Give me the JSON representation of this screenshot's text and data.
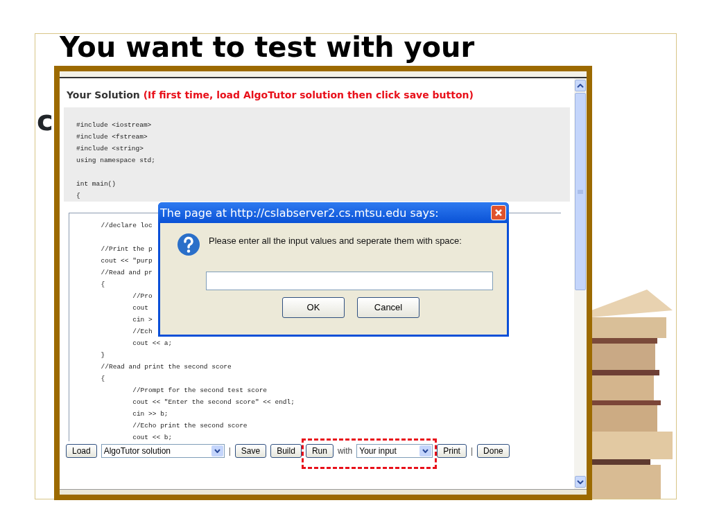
{
  "slide": {
    "title_line_1": "You want to test with your",
    "title_line_2_fragment": "c"
  },
  "window": {
    "heading": "Your Solution",
    "heading_note": "(If first time, load AlgoTutor solution then click save button)",
    "header_code": [
      [
        {
          "text": "#include <iostream>"
        },
        {
          "text": "#include <fstream>"
        },
        {
          "text": "#include <string>"
        },
        {
          "text": "using namespace std;"
        }
      ],
      [
        {
          "text": "int main()"
        },
        {
          "text": "{"
        }
      ]
    ],
    "editor_code": [
      [
        {
          "text": "\t//declare loc"
        }
      ],
      [
        {
          "text": "\t//Print the p"
        },
        {
          "text": "\tcout << \"purp"
        },
        {
          "text": "\t//Read and pr"
        },
        {
          "text": "\t{"
        },
        {
          "text": "\t\t//Pro"
        },
        {
          "text": "\t\tcout"
        },
        {
          "text": "\t\tcin >"
        },
        {
          "text": "\t\t//Ech"
        },
        {
          "text": "\t\tcout << a;"
        },
        {
          "text": "\t}"
        },
        {
          "text": "\t//Read and print the second score"
        },
        {
          "text": "\t{"
        },
        {
          "text": "\t\t//Prompt for the second test score"
        },
        {
          "text": "\t\tcout << \"Enter the second score\" << endl;"
        },
        {
          "text": "\t\tcin >> b;"
        },
        {
          "text": "\t\t//Echo print the second score"
        },
        {
          "text": "\t\tcout << b;"
        }
      ]
    ],
    "toolbar": [
      {
        "kind": "button",
        "label": "Load"
      },
      {
        "kind": "select",
        "value": "AlgoTutor solution"
      },
      {
        "kind": "separator",
        "label": "|"
      },
      {
        "kind": "button",
        "label": "Save"
      },
      {
        "kind": "button",
        "label": "Build"
      },
      {
        "kind": "button",
        "label": "Run",
        "highlighted": true
      },
      {
        "kind": "text",
        "label": "with",
        "highlighted": true
      },
      {
        "kind": "select",
        "value": "Your input",
        "highlighted": true
      },
      {
        "kind": "button",
        "label": "Print"
      },
      {
        "kind": "separator",
        "label": "|"
      },
      {
        "kind": "button",
        "label": "Done"
      }
    ]
  },
  "dialog": {
    "title": "The page at http://cslabserver2.cs.mtsu.edu says:",
    "message": "Please enter all the input values and seperate them with space:",
    "buttons": [
      "OK",
      "Cancel"
    ]
  }
}
